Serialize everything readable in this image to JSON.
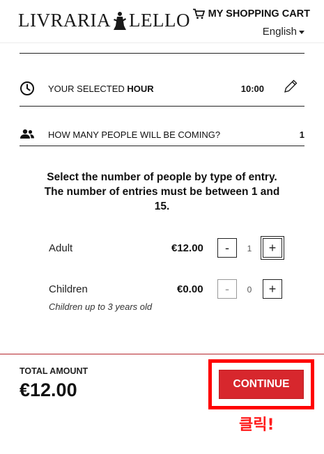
{
  "header": {
    "logo_left": "LIVRARIA",
    "logo_right": "LELLO",
    "cart_label": "MY SHOPPING CART",
    "language": "English"
  },
  "selection": {
    "hour_label_prefix": "YOUR SELECTED ",
    "hour_label_bold": "HOUR",
    "hour_value": "10:00",
    "people_label": "HOW MANY PEOPLE WILL BE COMING?",
    "people_value": "1"
  },
  "instructions": "Select the number of people by type of entry. The number of entries must be between 1 and 15.",
  "entries": [
    {
      "name": "Adult",
      "price": "€12.00",
      "quantity": "1",
      "minus": "-",
      "plus": "+",
      "note": ""
    },
    {
      "name": "Children",
      "price": "€0.00",
      "quantity": "0",
      "minus": "-",
      "plus": "+",
      "note": "Children up to 3 years old"
    }
  ],
  "footer": {
    "total_label": "TOTAL AMOUNT",
    "total_value": "€12.00",
    "continue_label": "CONTINUE",
    "annotation": "클릭!"
  },
  "colors": {
    "accent": "#d7272d",
    "highlight": "#ff0000"
  },
  "icons": [
    "cart-icon",
    "clock-icon",
    "people-icon",
    "pencil-icon"
  ]
}
